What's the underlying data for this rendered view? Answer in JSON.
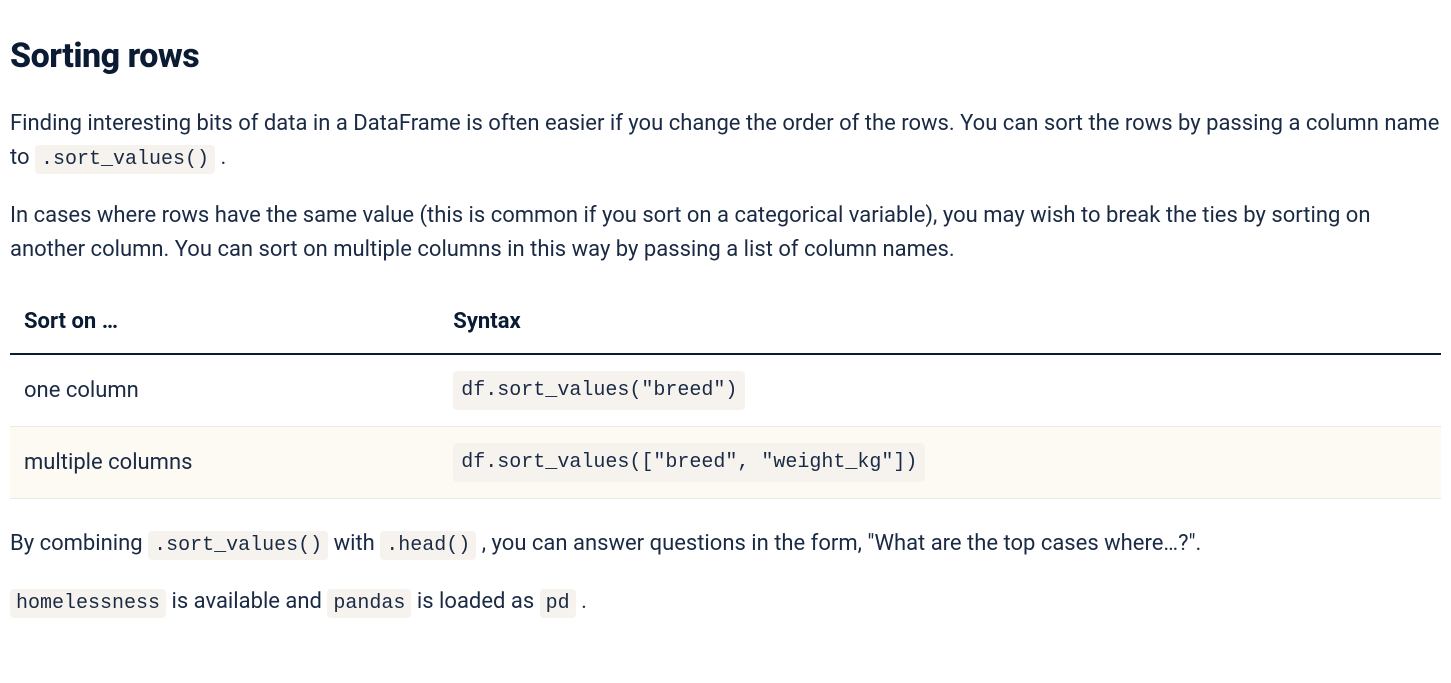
{
  "heading": "Sorting rows",
  "para1": {
    "t1": "Finding interesting bits of data in a DataFrame is often easier if you change the order of the rows. You can sort the rows by passing a column name to ",
    "code1": ".sort_values()",
    "t2": "."
  },
  "para2": "In cases where rows have the same value (this is common if you sort on a categorical variable), you may wish to break the ties by sorting on another column. You can sort on multiple columns in this way by passing a list of column names.",
  "table": {
    "headers": {
      "c1": "Sort on …",
      "c2": "Syntax"
    },
    "rows": [
      {
        "c1": "one column",
        "c2": "df.sort_values(\"breed\")"
      },
      {
        "c1": "multiple columns",
        "c2": "df.sort_values([\"breed\", \"weight_kg\"])"
      }
    ]
  },
  "para3": {
    "t1": "By combining ",
    "code1": ".sort_values()",
    "t2": " with ",
    "code2": ".head()",
    "t3": ", you can answer questions in the form, \"What are the top cases where…?\"."
  },
  "para4": {
    "code1": "homelessness",
    "t1": " is available and ",
    "code2": "pandas",
    "t2": " is loaded as ",
    "code3": "pd",
    "t3": "."
  }
}
